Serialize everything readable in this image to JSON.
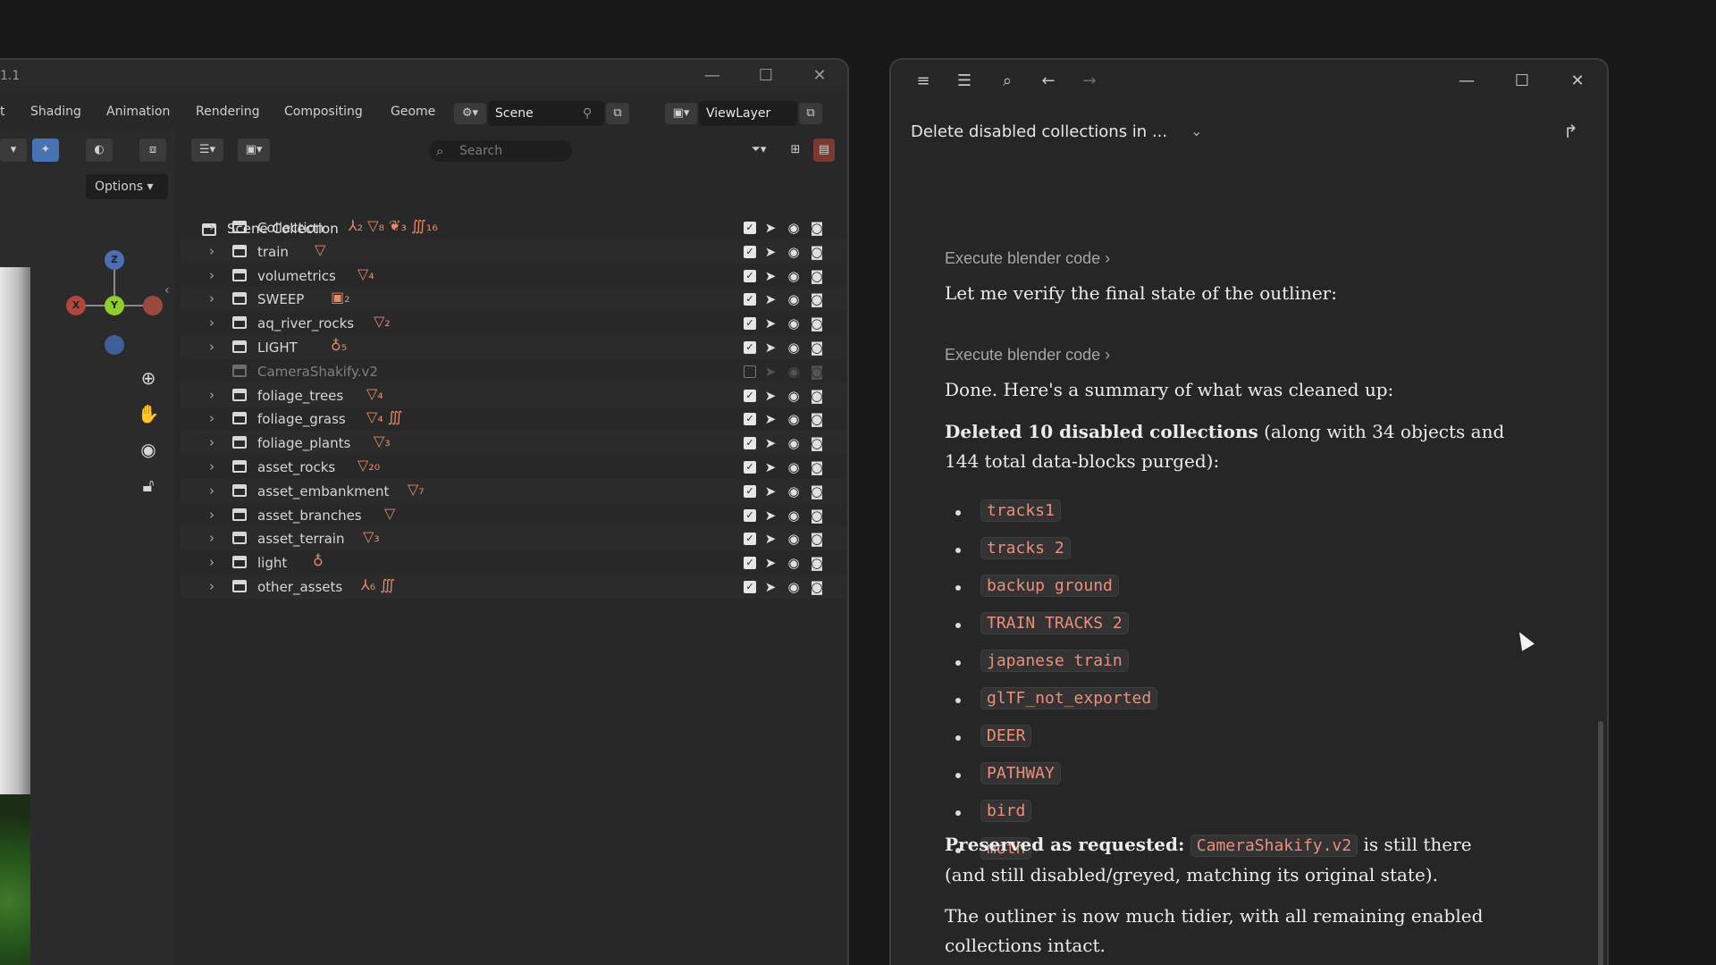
{
  "blender": {
    "title": "1.1",
    "tabs": [
      "t",
      "Shading",
      "Animation",
      "Rendering",
      "Compositing",
      "Geome"
    ],
    "scene_label": "Scene",
    "viewlayer_label": "ViewLayer",
    "options_label": "Options",
    "search_placeholder": "Search",
    "scene_collection_label": "Scene Collection",
    "gizmo": {
      "z": "Z",
      "y": "Y",
      "x": "X"
    },
    "collections": [
      {
        "name": "Collection",
        "badges": "⅄₂ ▽₈ ❦₃ ∭₁₆",
        "enabled": true
      },
      {
        "name": "train",
        "badges": "▽",
        "enabled": true
      },
      {
        "name": "volumetrics",
        "badges": "▽₄",
        "enabled": true
      },
      {
        "name": "SWEEP",
        "badges": "▣₂",
        "enabled": true
      },
      {
        "name": "aq_river_rocks",
        "badges": "▽₂",
        "enabled": true
      },
      {
        "name": "LIGHT",
        "badges": "♁₅",
        "enabled": true
      },
      {
        "name": "CameraShakify.v2",
        "badges": "",
        "enabled": false
      },
      {
        "name": "foliage_trees",
        "badges": "▽₄",
        "enabled": true
      },
      {
        "name": "foliage_grass",
        "badges": "▽₄ ∭",
        "enabled": true
      },
      {
        "name": "foliage_plants",
        "badges": "▽₃",
        "enabled": true
      },
      {
        "name": "asset_rocks",
        "badges": "▽₂₀",
        "enabled": true
      },
      {
        "name": "asset_embankment",
        "badges": "▽₇",
        "enabled": true
      },
      {
        "name": "asset_branches",
        "badges": "▽",
        "enabled": true
      },
      {
        "name": "asset_terrain",
        "badges": "▽₃",
        "enabled": true
      },
      {
        "name": "light",
        "badges": "♁",
        "enabled": true
      },
      {
        "name": "other_assets",
        "badges": "⅄₆ ∭",
        "enabled": true
      }
    ]
  },
  "chat": {
    "title": "Delete disabled collections in ...",
    "exec_label_1": "Execute blender code",
    "exec_label_2": "Execute blender code",
    "verify_text": "Let me verify the final state of the outliner:",
    "done_text": "Done. Here's a summary of what was cleaned up:",
    "deleted_bold": "Deleted 10 disabled collections",
    "deleted_rest": " (along with 34 objects and 144 total data-blocks purged):",
    "deleted_items": [
      "tracks1",
      "tracks 2",
      "backup ground",
      "TRAIN TRACKS 2",
      "japanese train",
      "glTF_not_exported",
      "DEER",
      "PATHWAY",
      "bird",
      "moth"
    ],
    "preserved_bold": "Preserved as requested:",
    "preserved_code": "CameraShakify.v2",
    "preserved_rest": " is still there (and still disabled/greyed, matching its original state).",
    "final_text": "The outliner is now much tidier, with all remaining enabled collections intact."
  },
  "colors": {
    "accent": "#4772b3",
    "code_text": "#eb8e7e",
    "badge": "#e58a6b"
  }
}
